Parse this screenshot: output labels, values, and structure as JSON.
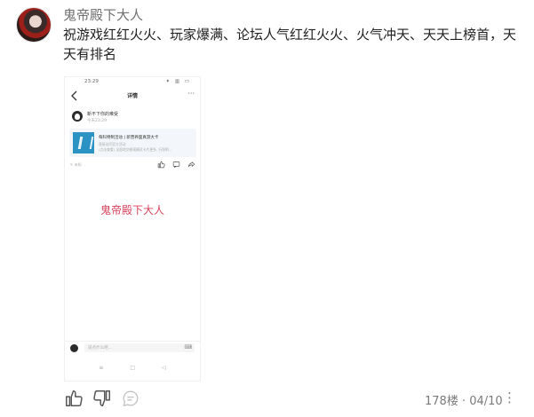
{
  "comment": {
    "username": "鬼帝殿下大人",
    "text": "祝游戏红红火火、玩家爆满、论坛人气红红火火、火气冲天、天天上榜首，天天有排名",
    "floor_label": "178楼 · 04/10"
  },
  "screenshot": {
    "status_time": "23:29",
    "status_icons": "✦ ▥ ▭",
    "nav_title": "详情",
    "nav_more": "···",
    "post_user": "新不下你的难受",
    "post_time": "今天23:29",
    "link_title": "每科特制活动 | 新营养面真游大卡",
    "link_sub1": "直接访问官方活动",
    "link_sub2": "(点击查看) 全面地交替现精灵卡片更多, 行到明...",
    "post_meta": "✎ 未知",
    "watermark": "鬼帝殿下大人",
    "input_placeholder": "说点什么吧...",
    "sys_nav": [
      "≡",
      "□",
      "◁"
    ]
  },
  "icons": {
    "like": "thumbs-up-icon",
    "dislike": "thumbs-down-icon",
    "reply": "comment-bubble-icon",
    "more": "more-icon"
  }
}
